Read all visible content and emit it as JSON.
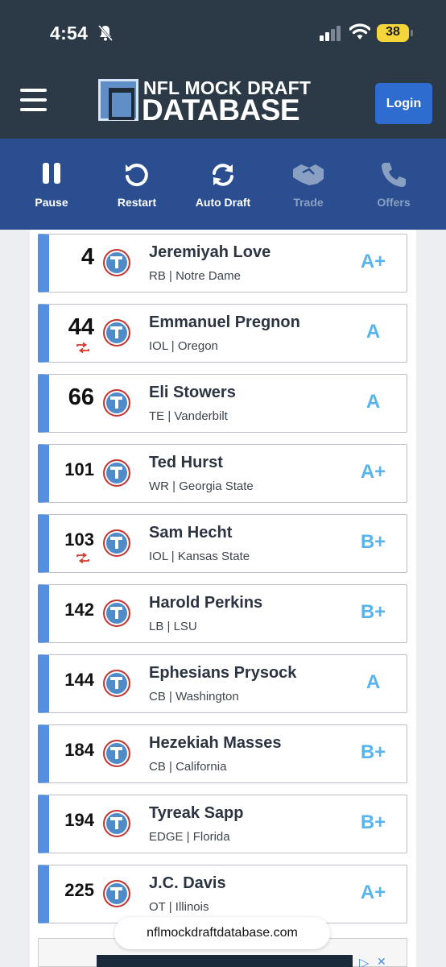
{
  "status": {
    "time": "4:54",
    "battery": "38"
  },
  "header": {
    "logo_top": "NFL MOCK DRAFT",
    "logo_bottom": "DATABASE",
    "login_label": "Login"
  },
  "toolbar": {
    "pause": "Pause",
    "restart": "Restart",
    "auto_draft": "Auto Draft",
    "trade": "Trade",
    "offers": "Offers"
  },
  "picks": [
    {
      "pick": "4",
      "name": "Jeremiyah Love",
      "meta": "RB | Notre Dame",
      "grade": "A+",
      "traded": false
    },
    {
      "pick": "44",
      "name": "Emmanuel Pregnon",
      "meta": "IOL | Oregon",
      "grade": "A",
      "traded": true
    },
    {
      "pick": "66",
      "name": "Eli Stowers",
      "meta": "TE | Vanderbilt",
      "grade": "A",
      "traded": false
    },
    {
      "pick": "101",
      "name": "Ted Hurst",
      "meta": "WR | Georgia State",
      "grade": "A+",
      "traded": false
    },
    {
      "pick": "103",
      "name": "Sam Hecht",
      "meta": "IOL | Kansas State",
      "grade": "B+",
      "traded": true
    },
    {
      "pick": "142",
      "name": "Harold Perkins",
      "meta": "LB | LSU",
      "grade": "B+",
      "traded": false
    },
    {
      "pick": "144",
      "name": "Ephesians Prysock",
      "meta": "CB | Washington",
      "grade": "A",
      "traded": false
    },
    {
      "pick": "184",
      "name": "Hezekiah Masses",
      "meta": "CB | California",
      "grade": "B+",
      "traded": false
    },
    {
      "pick": "194",
      "name": "Tyreak Sapp",
      "meta": "EDGE | Florida",
      "grade": "B+",
      "traded": false
    },
    {
      "pick": "225",
      "name": "J.C. Davis",
      "meta": "OT | Illinois",
      "grade": "A+",
      "traded": false
    }
  ],
  "browser": {
    "url": "nflmockdraftdatabase.com"
  },
  "colors": {
    "header_bg": "#2c3a47",
    "toolbar_bg": "#2a4e8f",
    "card_accent": "#5590e0",
    "grade": "#58b4ec",
    "login_bg": "#2e6cd0"
  }
}
